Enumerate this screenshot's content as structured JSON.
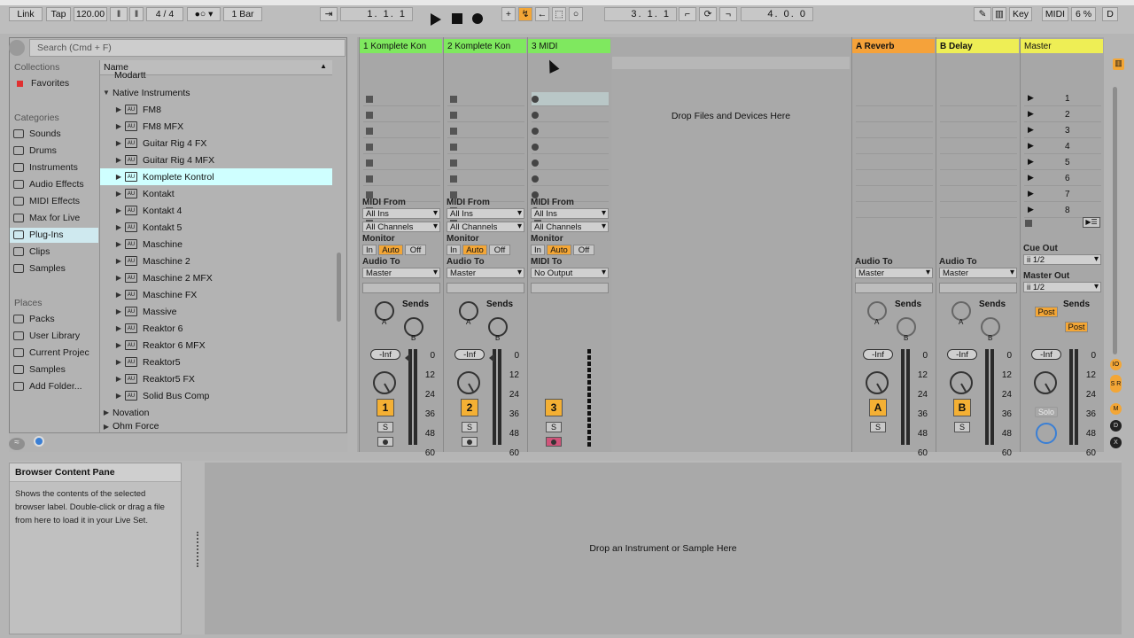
{
  "transport": {
    "link": "Link",
    "tap": "Tap",
    "tempo": "120.00",
    "sig_num": "4",
    "sig_slash": "/",
    "sig_den": "4",
    "quant": "1 Bar",
    "arr_pos": "1.   1.   1",
    "loop_start": "3.   1.   1",
    "loop_len": "4.   0.   0",
    "key": "Key",
    "midi": "MIDI",
    "cpu": "6 %",
    "d": "D"
  },
  "browser": {
    "search_placeholder": "Search (Cmd + F)",
    "collections_header": "Collections",
    "favorites": "Favorites",
    "categories_header": "Categories",
    "categories": [
      "Sounds",
      "Drums",
      "Instruments",
      "Audio Effects",
      "MIDI Effects",
      "Max for Live",
      "Plug-Ins",
      "Clips",
      "Samples"
    ],
    "places_header": "Places",
    "places": [
      "Packs",
      "User Library",
      "Current Projec",
      "Samples",
      "Add Folder..."
    ],
    "list_header": "Name",
    "cut_top": "Modartt",
    "folder": "Native Instruments",
    "items": [
      "FM8",
      "FM8 MFX",
      "Guitar Rig 4 FX",
      "Guitar Rig 4 MFX",
      "Komplete Kontrol",
      "Kontakt",
      "Kontakt 4",
      "Kontakt 5",
      "Maschine",
      "Maschine 2",
      "Maschine 2 MFX",
      "Maschine FX",
      "Massive",
      "Reaktor 6",
      "Reaktor 6 MFX",
      "Reaktor5",
      "Reaktor5 FX",
      "Solid Bus Comp"
    ],
    "folder2": "Novation",
    "folder3": "Ohm Force"
  },
  "tracks": [
    {
      "name": "1 Komplete Kon",
      "color": "#7fe85f",
      "num": "1",
      "io": {
        "from_label": "MIDI From",
        "from": "All Ins",
        "chan": "All Channels",
        "mon_label": "Monitor",
        "mon": [
          "In",
          "Auto",
          "Off"
        ],
        "to_label": "Audio To",
        "to": "Master"
      }
    },
    {
      "name": "2 Komplete Kon",
      "color": "#7fe85f",
      "num": "2",
      "io": {
        "from_label": "MIDI From",
        "from": "All Ins",
        "chan": "All Channels",
        "mon_label": "Monitor",
        "mon": [
          "In",
          "Auto",
          "Off"
        ],
        "to_label": "Audio To",
        "to": "Master"
      }
    },
    {
      "name": "3 MIDI",
      "color": "#7fe85f",
      "num": "3",
      "io": {
        "from_label": "MIDI From",
        "from": "All Ins",
        "chan": "All Channels",
        "mon_label": "Monitor",
        "mon": [
          "In",
          "Auto",
          "Off"
        ],
        "to_label": "MIDI To",
        "to": "No Output"
      }
    }
  ],
  "returns": [
    {
      "name": "A Reverb",
      "color": "#f5a23a",
      "num": "A",
      "to_label": "Audio To",
      "to": "Master"
    },
    {
      "name": "B Delay",
      "color": "#eeee55",
      "num": "B",
      "to_label": "Audio To",
      "to": "Master"
    }
  ],
  "master": {
    "name": "Master",
    "color": "#eeee55",
    "scenes": [
      "1",
      "2",
      "3",
      "4",
      "5",
      "6",
      "7",
      "8"
    ],
    "cue_label": "Cue Out",
    "cue": "ii 1/2",
    "out_label": "Master Out",
    "out": "ii 1/2",
    "post": "Post",
    "solo": "Solo"
  },
  "mixer": {
    "sends": "Sends",
    "inf": "-Inf",
    "solo": "S",
    "scale": [
      "0",
      "12",
      "24",
      "36",
      "48",
      "60"
    ],
    "knob_a": "A",
    "knob_b": "B"
  },
  "drop_devices": "Drop Files and Devices Here",
  "info": {
    "title": "Browser Content Pane",
    "text": "Shows the contents of the selected browser label. Double-click or drag a file from here to load it in your Live Set."
  },
  "drop_instrument": "Drop an Instrument or Sample Here"
}
